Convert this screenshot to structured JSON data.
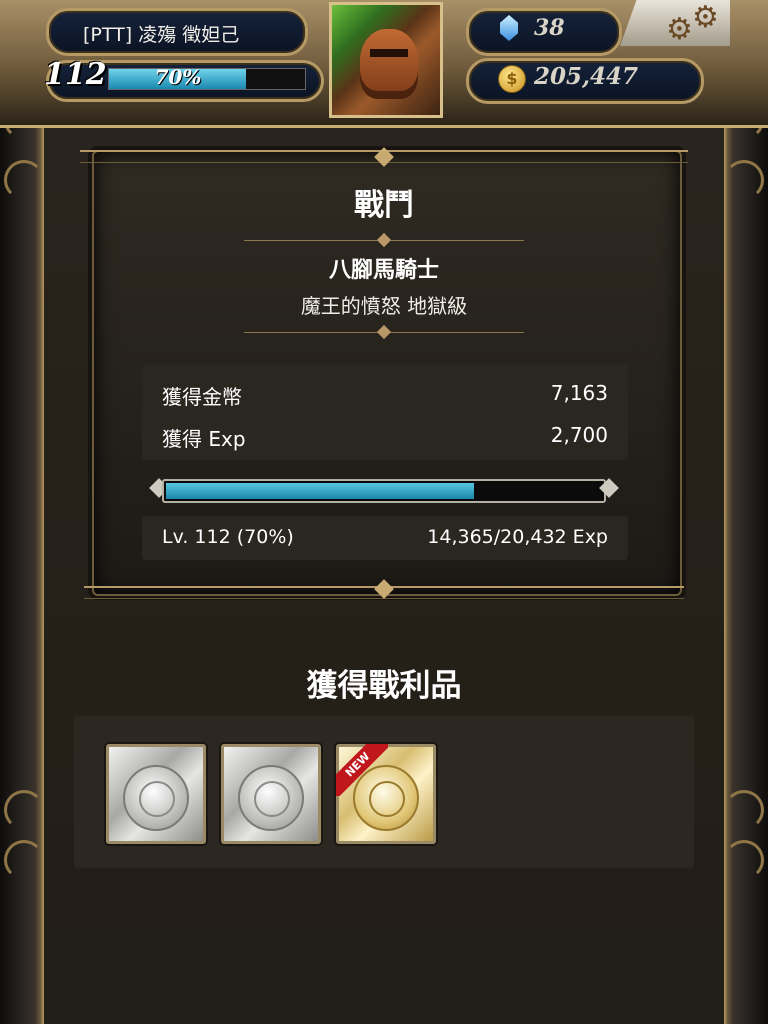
{
  "player": {
    "name": "[PTT] 凌殤 徵妲己",
    "level": "112",
    "exp_percent_text": "70%",
    "exp_fraction": 0.7,
    "gems": "38",
    "gold": "205,447"
  },
  "battle": {
    "title": "戰鬥",
    "enemy_name": "八腳馬騎士",
    "stage": "魔王的憤怒 地獄級",
    "gold_label": "獲得金幣",
    "gold_value": "7,163",
    "exp_label": "獲得 Exp",
    "exp_value": "2,700",
    "exp_bar_fraction": 0.7,
    "level_text": "Lv. 112 (70%)",
    "exp_progress": "14,365/20,432 Exp"
  },
  "loot": {
    "title": "獲得戰利品",
    "items": [
      {
        "type": "silver-medal-card",
        "badge": ""
      },
      {
        "type": "silver-medal-card",
        "badge": ""
      },
      {
        "type": "gold-medal-card",
        "badge": "NEW"
      }
    ]
  },
  "colors": {
    "exp_bar": "#1a86aa",
    "new_ribbon": "#c0171d",
    "frame_gold": "#b59a66"
  }
}
